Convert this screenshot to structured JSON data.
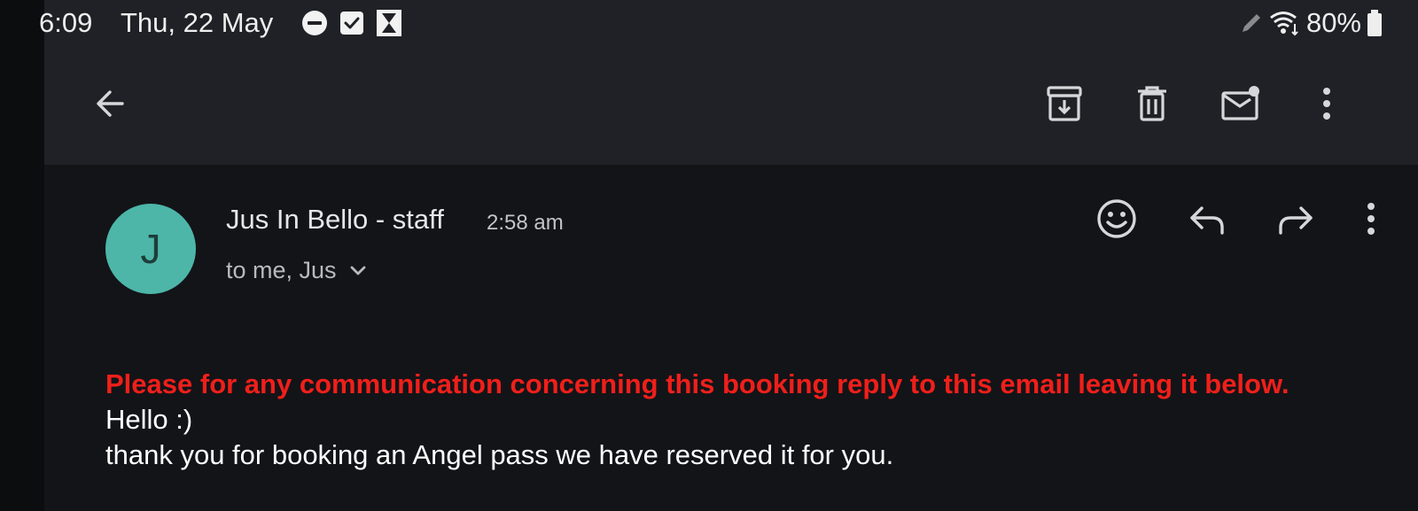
{
  "status_bar": {
    "time": "6:09",
    "date": "Thu, 22 May",
    "battery": "80%",
    "left_icons": [
      "do-not-disturb-icon",
      "checkbox-icon",
      "hourglass-icon"
    ],
    "right_icons": [
      "pen-icon",
      "wifi-icon",
      "battery-icon"
    ]
  },
  "app_bar": {
    "actions": [
      "back-arrow-icon",
      "archive-icon",
      "delete-icon",
      "mark-unread-icon",
      "more-vert-icon"
    ]
  },
  "email": {
    "avatar_letter": "J",
    "avatar_color": "#4db6a8",
    "sender": "Jus In Bello - staff",
    "time": "2:58 am",
    "recipients": "to me, Jus",
    "header_actions": [
      "emoji-icon",
      "reply-icon",
      "forward-icon",
      "more-vert-icon"
    ],
    "body": {
      "warning": "Please for any communication concerning this booking reply to this email leaving it below.",
      "warning_color": "#f01f1a",
      "greeting": "Hello :)",
      "message": "thank you for booking an Angel pass we have reserved it for you."
    }
  }
}
